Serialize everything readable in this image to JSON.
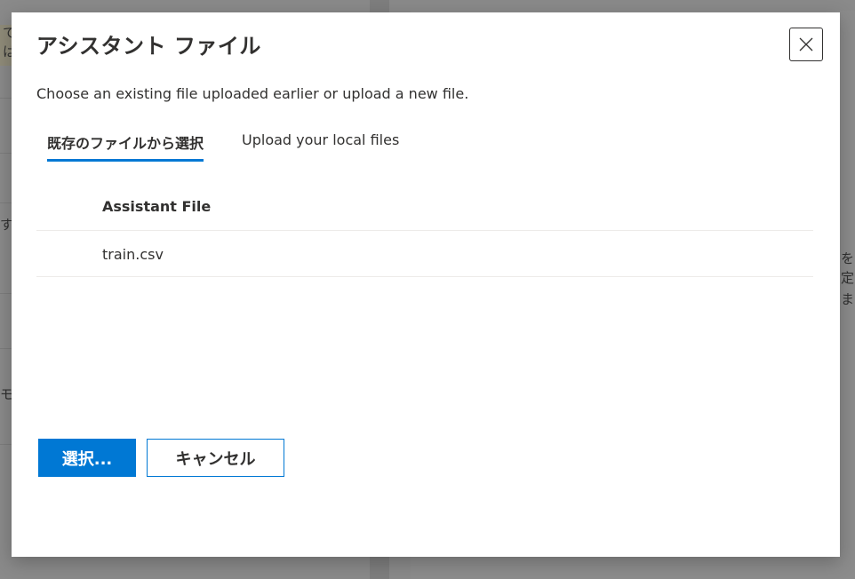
{
  "background": {
    "left_fragments": [
      "て",
      "は",
      "す",
      "モ"
    ],
    "right_fragments": [
      "を",
      "定",
      "ま"
    ]
  },
  "dialog": {
    "title": "アシスタント ファイル",
    "subtitle": "Choose an existing file uploaded earlier or upload a new file.",
    "close_icon": "close-icon",
    "tabs": [
      {
        "label": "既存のファイルから選択",
        "selected": true
      },
      {
        "label": "Upload your local files",
        "selected": false
      }
    ],
    "table": {
      "column_header": "Assistant File",
      "rows": [
        {
          "file": "train.csv"
        }
      ]
    },
    "buttons": {
      "select_label": "選択...",
      "cancel_label": "キャンセル"
    },
    "colors": {
      "accent": "#0078d4",
      "text": "#323130",
      "overlay": "#7a7a7a"
    }
  }
}
